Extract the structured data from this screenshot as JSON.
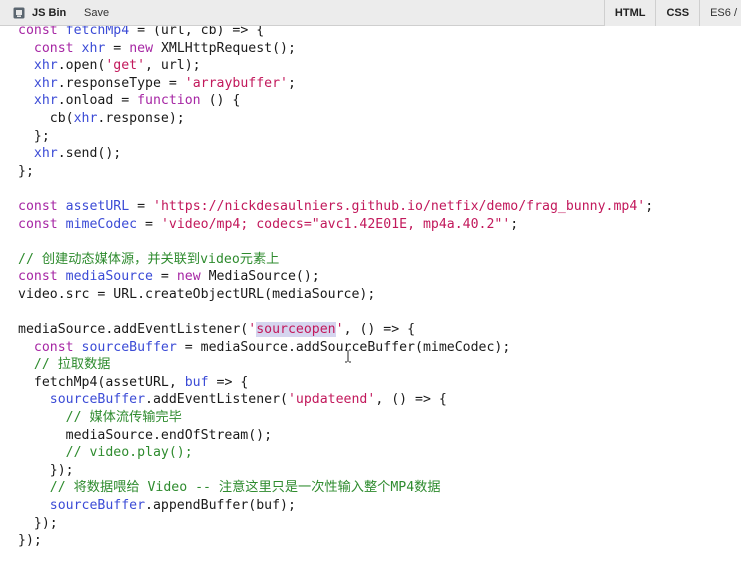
{
  "toolbar": {
    "app_name": "JS Bin",
    "save_label": "Save",
    "tabs": [
      {
        "label": "HTML"
      },
      {
        "label": "CSS"
      },
      {
        "label": "ES6 /"
      }
    ]
  },
  "editor": {
    "lines": [
      [
        {
          "t": "const ",
          "c": "kw"
        },
        {
          "t": "fetchMp4",
          "c": "var"
        },
        {
          "t": " = (url, cb) => {",
          "c": ""
        }
      ],
      [
        {
          "t": "  const ",
          "c": "kw"
        },
        {
          "t": "xhr",
          "c": "var"
        },
        {
          "t": " = ",
          "c": ""
        },
        {
          "t": "new ",
          "c": "kw"
        },
        {
          "t": "XMLHttpRequest();",
          "c": ""
        }
      ],
      [
        {
          "t": "  xhr",
          "c": "var"
        },
        {
          "t": ".open(",
          "c": ""
        },
        {
          "t": "'get'",
          "c": "str"
        },
        {
          "t": ", url);",
          "c": ""
        }
      ],
      [
        {
          "t": "  xhr",
          "c": "var"
        },
        {
          "t": ".responseType = ",
          "c": ""
        },
        {
          "t": "'arraybuffer'",
          "c": "str"
        },
        {
          "t": ";",
          "c": ""
        }
      ],
      [
        {
          "t": "  xhr",
          "c": "var"
        },
        {
          "t": ".onload = ",
          "c": ""
        },
        {
          "t": "function",
          "c": "kw"
        },
        {
          "t": " () {",
          "c": ""
        }
      ],
      [
        {
          "t": "    cb(",
          "c": ""
        },
        {
          "t": "xhr",
          "c": "var"
        },
        {
          "t": ".response);",
          "c": ""
        }
      ],
      [
        {
          "t": "  };",
          "c": ""
        }
      ],
      [
        {
          "t": "  xhr",
          "c": "var"
        },
        {
          "t": ".send();",
          "c": ""
        }
      ],
      [
        {
          "t": "};",
          "c": ""
        }
      ],
      [],
      [
        {
          "t": "const ",
          "c": "kw"
        },
        {
          "t": "assetURL",
          "c": "var"
        },
        {
          "t": " = ",
          "c": ""
        },
        {
          "t": "'https://nickdesaulniers.github.io/netfix/demo/frag_bunny.mp4'",
          "c": "str"
        },
        {
          "t": ";",
          "c": ""
        }
      ],
      [
        {
          "t": "const ",
          "c": "kw"
        },
        {
          "t": "mimeCodec",
          "c": "var"
        },
        {
          "t": " = ",
          "c": ""
        },
        {
          "t": "'video/mp4; codecs=\"avc1.42E01E, mp4a.40.2\"'",
          "c": "str"
        },
        {
          "t": ";",
          "c": ""
        }
      ],
      [],
      [
        {
          "t": "// 创建动态媒体源，并关联到video元素上",
          "c": "cm"
        }
      ],
      [
        {
          "t": "const ",
          "c": "kw"
        },
        {
          "t": "mediaSource",
          "c": "var"
        },
        {
          "t": " = ",
          "c": ""
        },
        {
          "t": "new ",
          "c": "kw"
        },
        {
          "t": "MediaSource();",
          "c": ""
        }
      ],
      [
        {
          "t": "video.src = URL.createObjectURL(mediaSource);",
          "c": ""
        }
      ],
      [],
      [
        {
          "t": "mediaSource.addEventListener(",
          "c": ""
        },
        {
          "t": "'",
          "c": "str"
        },
        {
          "t": "sourceopen",
          "c": "str hl"
        },
        {
          "t": "'",
          "c": "str"
        },
        {
          "t": ", () => {",
          "c": ""
        }
      ],
      [
        {
          "t": "  const ",
          "c": "kw"
        },
        {
          "t": "sourceBuffer",
          "c": "var"
        },
        {
          "t": " = mediaSource.addSourceBuffer(mimeCodec);",
          "c": ""
        }
      ],
      [
        {
          "t": "  // 拉取数据",
          "c": "cm"
        }
      ],
      [
        {
          "t": "  fetchMp4(assetURL, ",
          "c": ""
        },
        {
          "t": "buf",
          "c": "var"
        },
        {
          "t": " => {",
          "c": ""
        }
      ],
      [
        {
          "t": "    sourceBuffer",
          "c": "var"
        },
        {
          "t": ".addEventListener(",
          "c": ""
        },
        {
          "t": "'updateend'",
          "c": "str"
        },
        {
          "t": ", () => {",
          "c": ""
        }
      ],
      [
        {
          "t": "      // 媒体流传输完毕",
          "c": "cm"
        }
      ],
      [
        {
          "t": "      mediaSource.endOfStream();",
          "c": ""
        }
      ],
      [
        {
          "t": "      // video.play();",
          "c": "cm"
        }
      ],
      [
        {
          "t": "    });",
          "c": ""
        }
      ],
      [
        {
          "t": "    // 将数据喂给 Video -- 注意这里只是一次性输入整个MP4数据",
          "c": "cm"
        }
      ],
      [
        {
          "t": "    sourceBuffer",
          "c": "var"
        },
        {
          "t": ".appendBuffer(buf);",
          "c": ""
        }
      ],
      [
        {
          "t": "  });",
          "c": ""
        }
      ],
      [
        {
          "t": "});",
          "c": ""
        }
      ]
    ]
  },
  "icons": {
    "logo": "jsbin-logo-icon",
    "cursor": "text-cursor-icon"
  },
  "colors": {
    "keyword": "#a626a4",
    "variable": "#3b4bd6",
    "string": "#c2185b",
    "comment": "#2e8b2e",
    "selection": "#d5d5ef"
  }
}
